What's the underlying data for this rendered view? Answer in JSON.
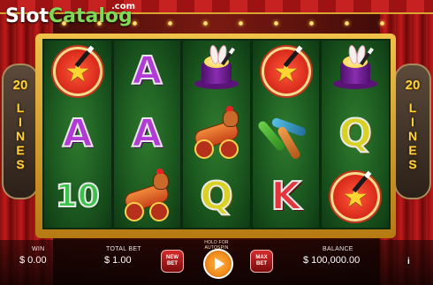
{
  "logo": {
    "part1": "Slot",
    "part2": "Catalog",
    "suffix": ".com"
  },
  "lines": {
    "count": "20",
    "word": [
      "L",
      "I",
      "N",
      "E",
      "S"
    ]
  },
  "reels": [
    [
      "star",
      "letter-A-purple",
      "letter-10-green"
    ],
    [
      "letter-A-purple",
      "letter-A-purple",
      "cannon"
    ],
    [
      "magic-hat",
      "cannon",
      "letter-Q-yellow"
    ],
    [
      "star",
      "juggling-pins",
      "letter-K-red"
    ],
    [
      "magic-hat",
      "letter-Q-yellow",
      "star"
    ]
  ],
  "symbol_text": {
    "A": "A",
    "Q": "Q",
    "K": "K",
    "ten": "10"
  },
  "star_glyph": "★",
  "bottom_bar": {
    "win_label": "WIN",
    "win_value": "$ 0.00",
    "total_bet_label": "TOTAL BET",
    "total_bet_value": "$ 1.00",
    "new_bet_label": "NEW BET",
    "autospin_hint": "HOLD FOR AUTOSPIN",
    "max_bet_label": "MAX BET",
    "balance_label": "BALANCE",
    "balance_value": "$ 100,000.00",
    "info_label": "i"
  },
  "colors": {
    "accent_gold": "#ffd23a",
    "logo_green": "#7ed957",
    "spin_orange": "#f08a1a",
    "reel_green": "#1c5a20"
  }
}
